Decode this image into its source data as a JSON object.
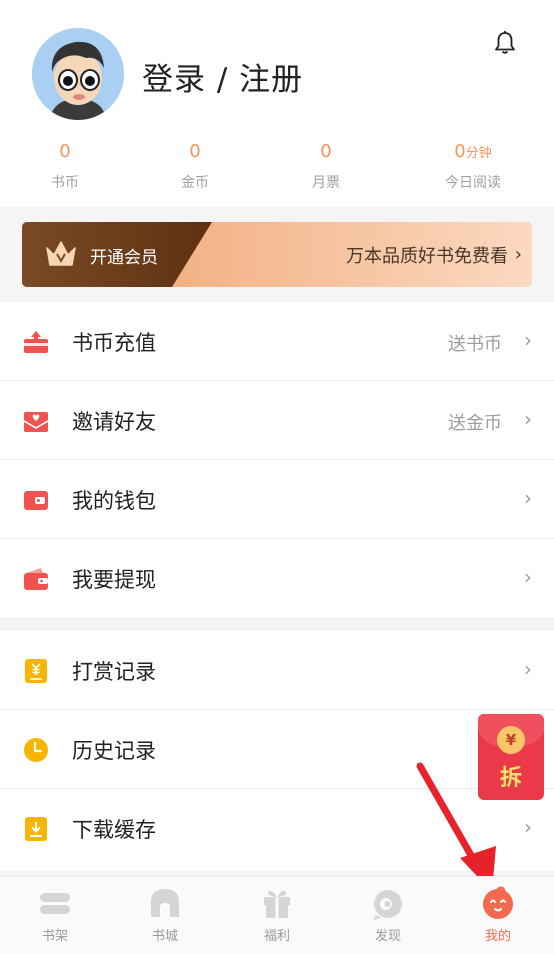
{
  "header": {
    "login_title": "登录 / 注册",
    "stats": [
      {
        "value": "0",
        "unit": "",
        "label": "书币"
      },
      {
        "value": "0",
        "unit": "",
        "label": "金币"
      },
      {
        "value": "0",
        "unit": "",
        "label": "月票"
      },
      {
        "value": "0",
        "unit": "分钟",
        "label": "今日阅读"
      }
    ]
  },
  "vip": {
    "open_label": "开通会员",
    "promo_text": "万本品质好书免费看",
    "chevron": "›"
  },
  "menu_group_1": [
    {
      "label": "书币充值",
      "extra": "送书币",
      "icon": "coin-recharge-icon"
    },
    {
      "label": "邀请好友",
      "extra": "送金币",
      "icon": "invite-letter-icon"
    },
    {
      "label": "我的钱包",
      "extra": "",
      "icon": "wallet-icon"
    },
    {
      "label": "我要提现",
      "extra": "",
      "icon": "withdraw-wallet-icon"
    }
  ],
  "menu_group_2": [
    {
      "label": "打赏记录",
      "extra": "",
      "icon": "reward-record-icon"
    },
    {
      "label": "历史记录",
      "extra": "",
      "icon": "clock-icon"
    },
    {
      "label": "下载缓存",
      "extra": "",
      "icon": "download-icon"
    }
  ],
  "chevron": "›",
  "red_packet": {
    "coin": "¥",
    "label": "拆"
  },
  "tabbar": [
    {
      "label": "书架",
      "icon": "bookshelf-icon",
      "active": false
    },
    {
      "label": "书城",
      "icon": "bookstore-icon",
      "active": false
    },
    {
      "label": "福利",
      "icon": "gift-icon",
      "active": false
    },
    {
      "label": "发现",
      "icon": "discover-icon",
      "active": false
    },
    {
      "label": "我的",
      "icon": "profile-face-icon",
      "active": true
    }
  ],
  "colors": {
    "accent": "#f0955f",
    "active_tab": "#f26a4f",
    "icon_red": "#ef5350",
    "icon_yellow": "#f7b500",
    "red_packet": "#ea3a4a"
  }
}
